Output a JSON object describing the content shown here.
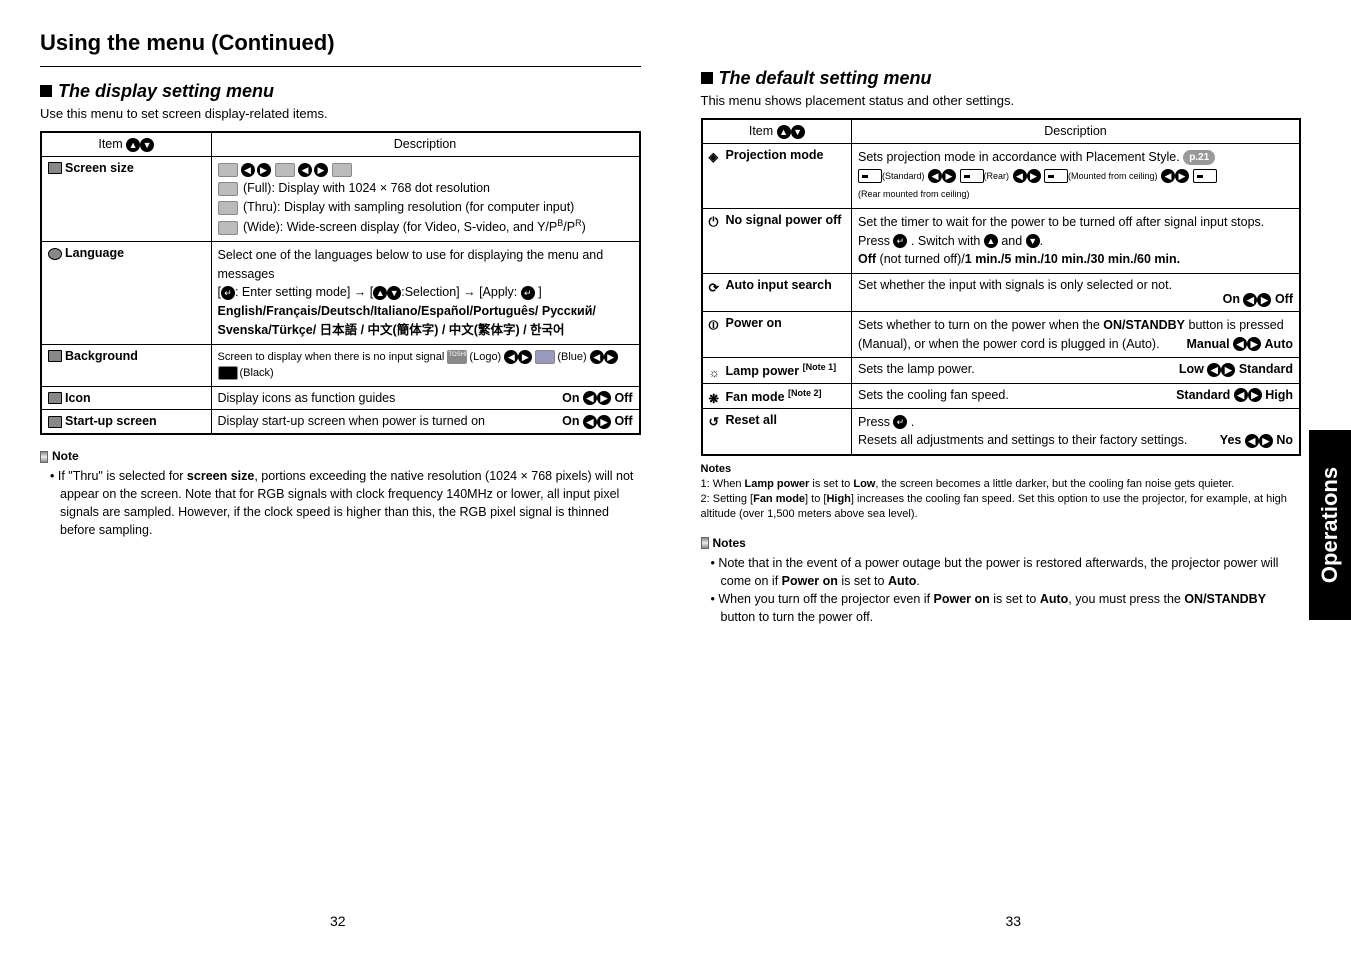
{
  "heading": "Using the menu (Continued)",
  "left": {
    "section_title": "The display setting menu",
    "intro": "Use this menu to set screen display-related items.",
    "th_item": "Item",
    "th_desc": "Description",
    "rows": {
      "screen_size": {
        "label": "Screen size",
        "full": " (Full):  Display with 1024 × 768 dot resolution",
        "thru": " (Thru): Display with sampling resolution (for computer input)",
        "wide": " (Wide):  Wide-screen display (for Video, S-video, and Y/P",
        "wide_sub1": "B",
        "wide_sep": "/P",
        "wide_sub2": "R",
        "wide_end": ")"
      },
      "language": {
        "label": "Language",
        "l1": "Select one of the languages below to use for displaying the menu and messages",
        "l2a": "[",
        "l2b": ": Enter setting mode] → [",
        "l2c": ":Selection] → [Apply: ",
        "l2d": " ]",
        "l3": "English/Français/Deutsch/Italiano/Español/Português/ Русский/",
        "l4": "Svenska/Türkçe/ 日本語 / 中文(簡体字) / 中文(繁体字) / 한국어"
      },
      "background": {
        "label": "Background",
        "prefix": "Screen to display when there is no input signal",
        "opt1": "TOSHIBA",
        "opt1s": "(Logo)",
        "opt2s": "(Blue)",
        "opt3s": "(Black)"
      },
      "icon": {
        "label": "Icon",
        "desc": "Display icons as function guides",
        "right": "On",
        "right2": "Off"
      },
      "start": {
        "label": "Start-up screen",
        "desc": "Display start-up screen when power is turned on",
        "right": "On",
        "right2": "Off"
      }
    },
    "note_head": "Note",
    "note1a": "If \"Thru\" is selected for ",
    "note1b": "screen size",
    "note1c": ", portions exceeding the native resolution (1024 × 768 pixels) will not appear on the screen. Note that for RGB signals with clock frequency 140MHz or lower, all input pixel signals are sampled. However, if the clock speed is higher than this, the RGB pixel signal is thinned before sampling."
  },
  "right": {
    "section_title": "The default setting menu",
    "intro": "This menu shows placement status and other settings.",
    "th_item": "Item",
    "th_desc": "Description",
    "rows": {
      "projection": {
        "label": "Projection mode",
        "desc": "Sets projection mode in accordance with Placement Style.",
        "pill": "p.21",
        "opt1": "(Standard)",
        "opt2": "(Rear)",
        "opt3": "(Mounted from ceiling)",
        "opt4": "(Rear mounted from ceiling)"
      },
      "nosignal": {
        "label": "No signal power off",
        "l1": "Set the timer to wait for the power to be turned off after signal input stops.",
        "l2a": "Press ",
        "l2b": " . Switch with ",
        "l2c": " and ",
        "l2d": ".",
        "l3a": "Off",
        "l3b": " (not turned off)/",
        "l3c": "1 min./5 min./10 min./30 min./60 min."
      },
      "autoinput": {
        "label": "Auto input search",
        "desc": "Set whether the input with signals is only selected or not.",
        "right": "On",
        "right2": "Off"
      },
      "poweron": {
        "label": "Power on",
        "l1a": "Sets whether to turn on the power when the ",
        "l1b": "ON/STANDBY",
        "l1c": " button is pressed (Manual), or when the power cord is plugged in (Auto).",
        "right": "Manual",
        "right2": "Auto"
      },
      "lamp": {
        "label": "Lamp power",
        "sup": "[Note 1]",
        "desc": "Sets the lamp power.",
        "right": "Low",
        "right2": "Standard"
      },
      "fan": {
        "label": "Fan mode",
        "sup": "[Note 2]",
        "desc": "Sets the cooling fan speed.",
        "right": "Standard",
        "right2": "High"
      },
      "reset": {
        "label": "Reset all",
        "l1a": "Press ",
        "l1b": " .",
        "l2": "Resets all adjustments and settings to their factory settings.",
        "right": "Yes",
        "right2": "No"
      }
    },
    "notes_head": "Notes",
    "notes1": "1: When Lamp power is set to Low, the screen becomes a little darker, but the cooling fan noise gets quieter.",
    "notes1_plain_a": "1: When ",
    "notes1_b1": "Lamp power",
    "notes1_c": " is set to ",
    "notes1_b2": "Low",
    "notes1_d": ", the screen becomes a little darker, but the cooling fan noise gets quieter.",
    "notes2_a": "2: Setting [",
    "notes2_b1": "Fan mode",
    "notes2_c": "] to [",
    "notes2_b2": "High",
    "notes2_d": "] increases the cooling fan speed.  Set this option to use the projector, for example, at high altitude (over 1,500 meters above sea level).",
    "notes_head2": "Notes",
    "bullet1_a": "Note that in the event of a power outage but the power is restored afterwards, the projector power will come on if ",
    "bullet1_b": "Power on",
    "bullet1_c": " is set to ",
    "bullet1_d": "Auto",
    "bullet1_e": ".",
    "bullet2_a": "When you turn off the projector even if ",
    "bullet2_b": "Power on",
    "bullet2_c": " is set to ",
    "bullet2_d": "Auto",
    "bullet2_e": ", you must press the ",
    "bullet2_f": "ON/STANDBY",
    "bullet2_g": " button to turn the power off."
  },
  "side_tab": "Operations",
  "page_left": "32",
  "page_right": "33"
}
